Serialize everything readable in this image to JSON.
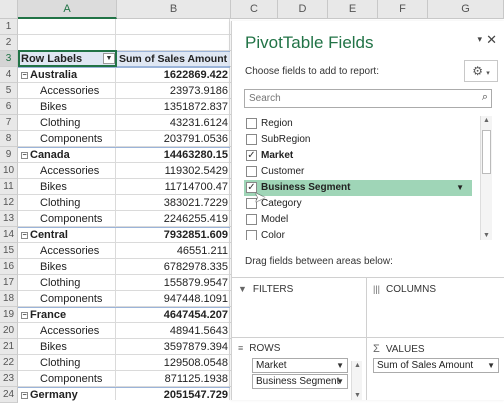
{
  "spreadsheet": {
    "columns": [
      "A",
      "B",
      "C",
      "D",
      "E",
      "F",
      "G"
    ],
    "selected_column": "A",
    "selected_row": "3",
    "header": {
      "row_labels": "Row Labels",
      "value_header": "Sum of Sales Amount",
      "filter_icon": "dropdown-filter-icon"
    },
    "rows": [
      {
        "num": "1",
        "label": "",
        "value": "",
        "level": 0
      },
      {
        "num": "2",
        "label": "",
        "value": "",
        "level": 0
      },
      {
        "num": "3",
        "label": "",
        "value": "",
        "level": -1
      },
      {
        "num": "4",
        "label": "Australia",
        "value": "1622869.422",
        "level": 1
      },
      {
        "num": "5",
        "label": "Accessories",
        "value": "23973.9186",
        "level": 2
      },
      {
        "num": "6",
        "label": "Bikes",
        "value": "1351872.837",
        "level": 2
      },
      {
        "num": "7",
        "label": "Clothing",
        "value": "43231.6124",
        "level": 2
      },
      {
        "num": "8",
        "label": "Components",
        "value": "203791.0536",
        "level": 2
      },
      {
        "num": "9",
        "label": "Canada",
        "value": "14463280.15",
        "level": 1
      },
      {
        "num": "10",
        "label": "Accessories",
        "value": "119302.5429",
        "level": 2
      },
      {
        "num": "11",
        "label": "Bikes",
        "value": "11714700.47",
        "level": 2
      },
      {
        "num": "12",
        "label": "Clothing",
        "value": "383021.7229",
        "level": 2
      },
      {
        "num": "13",
        "label": "Components",
        "value": "2246255.419",
        "level": 2
      },
      {
        "num": "14",
        "label": "Central",
        "value": "7932851.609",
        "level": 1
      },
      {
        "num": "15",
        "label": "Accessories",
        "value": "46551.211",
        "level": 2
      },
      {
        "num": "16",
        "label": "Bikes",
        "value": "6782978.335",
        "level": 2
      },
      {
        "num": "17",
        "label": "Clothing",
        "value": "155879.9547",
        "level": 2
      },
      {
        "num": "18",
        "label": "Components",
        "value": "947448.1091",
        "level": 2
      },
      {
        "num": "19",
        "label": "France",
        "value": "4647454.207",
        "level": 1
      },
      {
        "num": "20",
        "label": "Accessories",
        "value": "48941.5643",
        "level": 2
      },
      {
        "num": "21",
        "label": "Bikes",
        "value": "3597879.394",
        "level": 2
      },
      {
        "num": "22",
        "label": "Clothing",
        "value": "129508.0548",
        "level": 2
      },
      {
        "num": "23",
        "label": "Components",
        "value": "871125.1938",
        "level": 2
      },
      {
        "num": "24",
        "label": "Germany",
        "value": "2051547.729",
        "level": 1
      }
    ]
  },
  "pivot_pane": {
    "title": "PivotTable Fields",
    "subtitle": "Choose fields to add to report:",
    "search_placeholder": "Search",
    "fields": [
      {
        "label": "Region",
        "checked": false,
        "bold": false,
        "highlighted": false
      },
      {
        "label": "SubRegion",
        "checked": false,
        "bold": false,
        "highlighted": false
      },
      {
        "label": "Market",
        "checked": true,
        "bold": true,
        "highlighted": false
      },
      {
        "label": "Customer",
        "checked": false,
        "bold": false,
        "highlighted": false
      },
      {
        "label": "Business Segment",
        "checked": true,
        "bold": true,
        "highlighted": true
      },
      {
        "label": "Category",
        "checked": false,
        "bold": false,
        "highlighted": false
      },
      {
        "label": "Model",
        "checked": false,
        "bold": false,
        "highlighted": false
      },
      {
        "label": "Color",
        "checked": false,
        "bold": false,
        "highlighted": false
      }
    ],
    "drag_message": "Drag fields between areas below:",
    "areas": {
      "filters": "FILTERS",
      "columns": "COLUMNS",
      "rows": "ROWS",
      "values": "VALUES",
      "rows_items": [
        "Market",
        "Business Segment"
      ],
      "values_items": [
        "Sum of Sales Amount"
      ]
    }
  },
  "colors": {
    "accent": "#217346",
    "highlight": "#9fd5b7",
    "header_fill": "#dfe7f3"
  }
}
